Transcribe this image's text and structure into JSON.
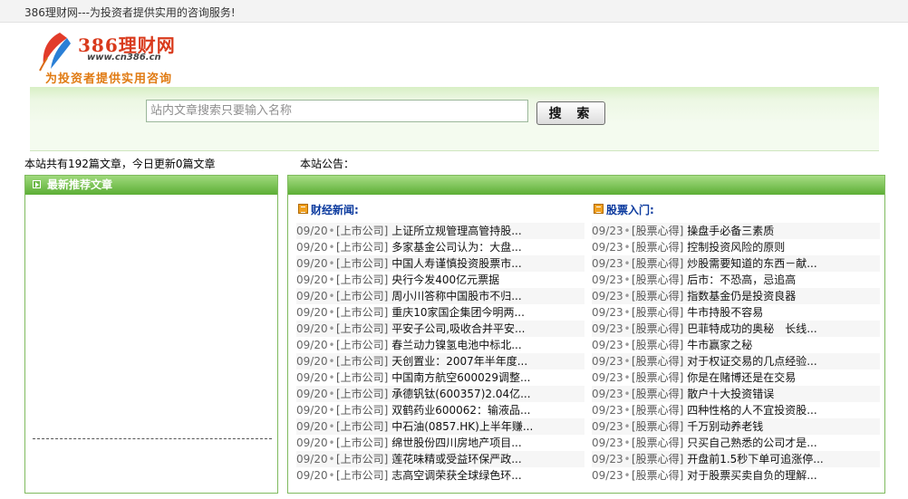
{
  "topbar": {
    "text": "386理财网---为投资者提供实用的咨询服务!"
  },
  "logo": {
    "name": "386理财网",
    "url": "www.cn386.cn",
    "slogan": "为投资者提供实用咨询"
  },
  "search": {
    "placeholder": "站内文章搜索只要输入名称",
    "button_label": "搜 索"
  },
  "stats": {
    "text": "本站共有192篇文章，今日更新0篇文章"
  },
  "notice": {
    "label": "本站公告："
  },
  "left_panel": {
    "title": "最新推荐文章"
  },
  "finance_news": {
    "title": "财经新闻:",
    "items": [
      {
        "date": "09/20",
        "category": "[上市公司]",
        "title": "上证所立规管理高管持股..."
      },
      {
        "date": "09/20",
        "category": "[上市公司]",
        "title": "多家基金公司认为：大盘..."
      },
      {
        "date": "09/20",
        "category": "[上市公司]",
        "title": "中国人寿谨慎投资股票市..."
      },
      {
        "date": "09/20",
        "category": "[上市公司]",
        "title": "央行今发400亿元票据"
      },
      {
        "date": "09/20",
        "category": "[上市公司]",
        "title": "周小川答称中国股市不归..."
      },
      {
        "date": "09/20",
        "category": "[上市公司]",
        "title": "重庆10家国企集团今明两..."
      },
      {
        "date": "09/20",
        "category": "[上市公司]",
        "title": "平安子公司,吸收合并平安..."
      },
      {
        "date": "09/20",
        "category": "[上市公司]",
        "title": "春兰动力镍氢电池中标北..."
      },
      {
        "date": "09/20",
        "category": "[上市公司]",
        "title": "天创置业：2007年半年度..."
      },
      {
        "date": "09/20",
        "category": "[上市公司]",
        "title": "中国南方航空600029调整..."
      },
      {
        "date": "09/20",
        "category": "[上市公司]",
        "title": "承德钒钛(600357)2.04亿..."
      },
      {
        "date": "09/20",
        "category": "[上市公司]",
        "title": "双鹤药业600062：输液品..."
      },
      {
        "date": "09/20",
        "category": "[上市公司]",
        "title": "中石油(0857.HK)上半年赚..."
      },
      {
        "date": "09/20",
        "category": "[上市公司]",
        "title": "绵世股份四川房地产项目..."
      },
      {
        "date": "09/20",
        "category": "[上市公司]",
        "title": "莲花味精或受益环保严政..."
      },
      {
        "date": "09/20",
        "category": "[上市公司]",
        "title": "志高空调荣获全球绿色环..."
      }
    ]
  },
  "stock_intro": {
    "title": "股票入门:",
    "items": [
      {
        "date": "09/23",
        "category": "[股票心得]",
        "title": "操盘手必备三素质"
      },
      {
        "date": "09/23",
        "category": "[股票心得]",
        "title": "控制投资风险的原则"
      },
      {
        "date": "09/23",
        "category": "[股票心得]",
        "title": "炒股需要知道的东西－献..."
      },
      {
        "date": "09/23",
        "category": "[股票心得]",
        "title": "后市：不恐高，忌追高"
      },
      {
        "date": "09/23",
        "category": "[股票心得]",
        "title": "指数基金仍是投资良器"
      },
      {
        "date": "09/23",
        "category": "[股票心得]",
        "title": "牛市持股不容易"
      },
      {
        "date": "09/23",
        "category": "[股票心得]",
        "title": "巴菲特成功的奥秘　长线..."
      },
      {
        "date": "09/23",
        "category": "[股票心得]",
        "title": "牛市赢家之秘"
      },
      {
        "date": "09/23",
        "category": "[股票心得]",
        "title": "对于权证交易的几点经验..."
      },
      {
        "date": "09/23",
        "category": "[股票心得]",
        "title": "你是在赌博还是在交易"
      },
      {
        "date": "09/23",
        "category": "[股票心得]",
        "title": "散户十大投资错误"
      },
      {
        "date": "09/23",
        "category": "[股票心得]",
        "title": "四种性格的人不宜投资股..."
      },
      {
        "date": "09/23",
        "category": "[股票心得]",
        "title": "千万别动养老钱"
      },
      {
        "date": "09/23",
        "category": "[股票心得]",
        "title": "只买自己熟悉的公司才是..."
      },
      {
        "date": "09/23",
        "category": "[股票心得]",
        "title": "开盘前1.5秒下单可追涨停..."
      },
      {
        "date": "09/23",
        "category": "[股票心得]",
        "title": "对于股票买卖自负的理解..."
      }
    ]
  },
  "colors": {
    "accent_green": "#5cae35",
    "link_blue": "#0b3a9e",
    "logo_red": "#d93a1c",
    "slogan_orange": "#e07a12"
  }
}
